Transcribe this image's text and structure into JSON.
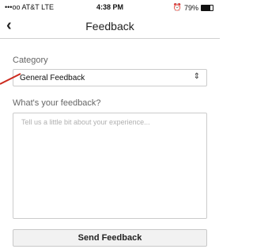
{
  "status_bar": {
    "carrier": "•••oo AT&T LTE",
    "time": "4:38 PM",
    "alarm_icon": "alarm-icon",
    "battery_percent": "79%",
    "battery_level": 0.79
  },
  "nav": {
    "back_icon": "chevron-left-icon",
    "title": "Feedback"
  },
  "form": {
    "category_label": "Category",
    "category_value": "General Feedback",
    "feedback_label": "What's your feedback?",
    "feedback_placeholder": "Tell us a little bit about your experience...",
    "submit_label": "Send Feedback"
  },
  "colors": {
    "annotation_red": "#cc2a1e"
  }
}
